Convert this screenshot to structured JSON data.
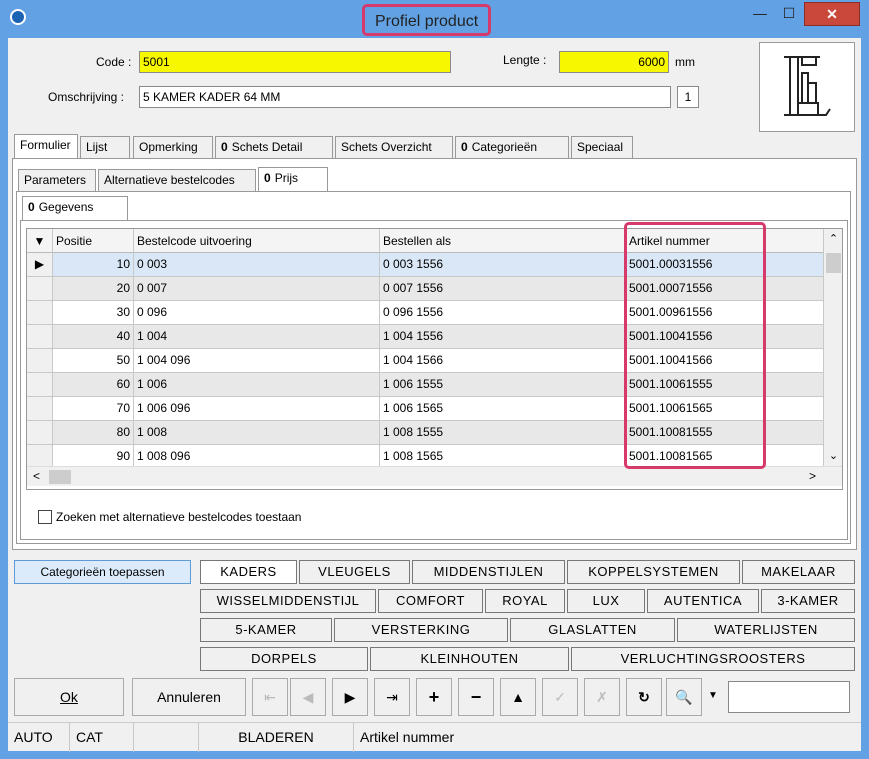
{
  "window": {
    "title": "Profiel product",
    "minimize": "—",
    "maximize": "☐",
    "close": "✕"
  },
  "header": {
    "code_label": "Code :",
    "code_value": "5001",
    "omschrijving_label": "Omschrijving :",
    "omschrijving_value": "5 KAMER KADER 64 MM",
    "count_value": "1",
    "lengte_label": "Lengte :",
    "lengte_value": "6000",
    "lengte_unit": "mm"
  },
  "main_tabs": [
    "Formulier",
    "Lijst",
    "Opmerking",
    "Schets Detail",
    "Schets Overzicht",
    "Categorieën",
    "Speciaal"
  ],
  "sub_tabs": [
    "Parameters",
    "Alternatieve bestelcodes",
    "Prijs"
  ],
  "inner_tabs": [
    "Gegevens"
  ],
  "grid": {
    "columns": [
      "Positie",
      "Bestelcode uitvoering",
      "Bestellen als",
      "Artikel nummer"
    ],
    "rows": [
      {
        "pos": "10",
        "code": "0 003",
        "als": "0 003 1556",
        "art": "5001.00031556"
      },
      {
        "pos": "20",
        "code": "0 007",
        "als": "0 007 1556",
        "art": "5001.00071556"
      },
      {
        "pos": "30",
        "code": "0 096",
        "als": "0 096 1556",
        "art": "5001.00961556"
      },
      {
        "pos": "40",
        "code": "1 004",
        "als": "1 004 1556",
        "art": "5001.10041556"
      },
      {
        "pos": "50",
        "code": "1 004 096",
        "als": "1 004 1566",
        "art": "5001.10041566"
      },
      {
        "pos": "60",
        "code": "1 006",
        "als": "1 006 1555",
        "art": "5001.10061555"
      },
      {
        "pos": "70",
        "code": "1 006 096",
        "als": "1 006 1565",
        "art": "5001.10061565"
      },
      {
        "pos": "80",
        "code": "1 008",
        "als": "1 008 1555",
        "art": "5001.10081555"
      },
      {
        "pos": "90",
        "code": "1 008 096",
        "als": "1 008 1565",
        "art": "5001.10081565"
      }
    ]
  },
  "checkbox_label": "Zoeken met alternatieve bestelcodes toestaan",
  "categories": {
    "apply_label": "Categorieën toepassen",
    "row1": [
      "KADERS",
      "VLEUGELS",
      "MIDDENSTIJLEN",
      "KOPPELSYSTEMEN",
      "MAKELAAR"
    ],
    "row2": [
      "WISSELMIDDENSTIJL",
      "COMFORT",
      "ROYAL",
      "LUX",
      "AUTENTICA",
      "3-KAMER"
    ],
    "row3": [
      "5-KAMER",
      "VERSTERKING",
      "GLASLATTEN",
      "WATERLIJSTEN"
    ],
    "row4": [
      "DORPELS",
      "KLEINHOUTEN",
      "VERLUCHTINGSROOSTERS"
    ]
  },
  "buttons": {
    "ok": "Ok",
    "cancel": "Annuleren"
  },
  "status": {
    "auto": "AUTO",
    "cat": "CAT",
    "mode": "BLADEREN",
    "field": "Artikel nummer"
  }
}
